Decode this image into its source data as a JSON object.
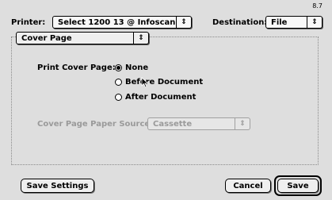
{
  "version": "8.7",
  "printer": {
    "label": "Printer:",
    "value": "Select 1200 13 @ Infoscan"
  },
  "destination": {
    "label": "Destination:",
    "value": "File"
  },
  "panel": {
    "value": "Cover Page"
  },
  "cover_page": {
    "label": "Print Cover Page:",
    "options": [
      "None",
      "Before Document",
      "After Document"
    ],
    "selected": "None"
  },
  "paper_source": {
    "label": "Cover Page Paper Source:",
    "value": "Cassette",
    "enabled": false
  },
  "buttons": {
    "save_settings": "Save Settings",
    "cancel": "Cancel",
    "save": "Save"
  },
  "icons": {
    "popup_arrows": "⇕",
    "pointer": "arrow-pointer-icon"
  }
}
